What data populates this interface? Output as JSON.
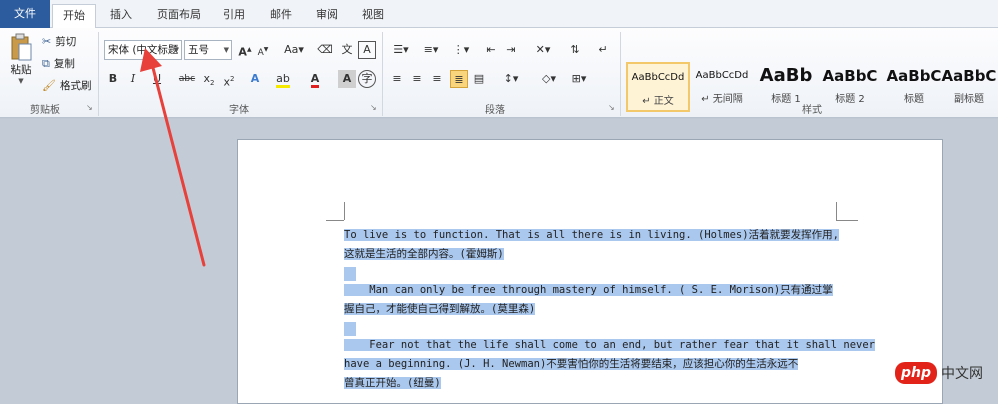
{
  "tabs": [
    {
      "label": "文件"
    },
    {
      "label": "开始"
    },
    {
      "label": "插入"
    },
    {
      "label": "页面布局"
    },
    {
      "label": "引用"
    },
    {
      "label": "邮件"
    },
    {
      "label": "审阅"
    },
    {
      "label": "视图"
    }
  ],
  "clipboard": {
    "paste": "粘贴",
    "cut": "剪切",
    "copy": "复制",
    "format_painter": "格式刷",
    "group_label": "剪贴板"
  },
  "font": {
    "name": "宋体 (中文标题",
    "size": "五号",
    "group_label": "字体"
  },
  "paragraph": {
    "group_label": "段落"
  },
  "styles": {
    "group_label": "样式",
    "items": [
      {
        "sample": "AaBbCcDd",
        "name": "↵ 正文"
      },
      {
        "sample": "AaBbCcDd",
        "name": "↵ 无间隔"
      },
      {
        "sample": "AaBb",
        "name": "标题 1"
      },
      {
        "sample": "AaBbC",
        "name": "标题 2"
      },
      {
        "sample": "AaBbC",
        "name": "标题"
      },
      {
        "sample": "AaBbC",
        "name": "副标题"
      }
    ]
  },
  "document": {
    "paragraphs": [
      {
        "lines": [
          "To live is to function. That is all there is in living. (Holmes)活着就要发挥作用,",
          "这就是生活的全部内容。(霍姆斯)"
        ]
      },
      {
        "lines": [
          "    Man can only be free through mastery of himself. ( S. E. Morison)只有通过掌",
          "握自己，才能使自己得到解放。(莫里森)"
        ]
      },
      {
        "lines": [
          "    Fear not that the life shall come to an end, but rather fear that it shall never",
          "have a beginning. (J. H. Newman)不要害怕你的生活将要结束，应该担心你的生活永远不",
          "曾真正开始。(纽曼)"
        ]
      }
    ]
  },
  "watermark": {
    "logo": "php",
    "text": "中文网"
  },
  "colors": {
    "file_tab": "#2c5c9e",
    "selection": "#aac8ee",
    "arrow": "#e8403a",
    "style_selected": "#fff3d6"
  }
}
